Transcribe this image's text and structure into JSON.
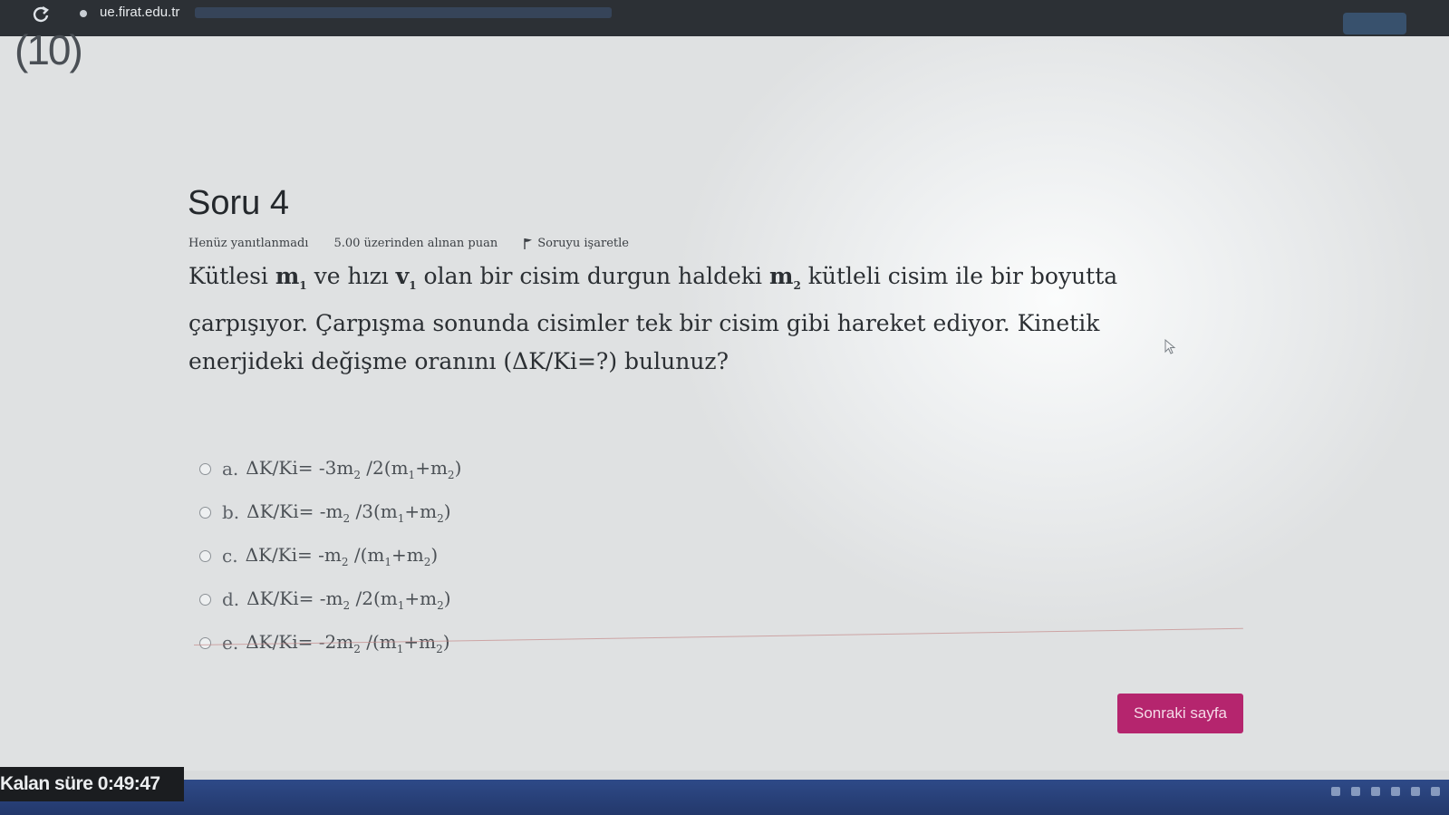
{
  "browser": {
    "url_host": "ue.firat.edu.tr"
  },
  "page": {
    "logo_fragment": "(10)"
  },
  "question": {
    "title": "Soru 4",
    "status": "Henüz yanıtlanmadı",
    "points": "5.00 üzerinden alınan puan",
    "flag_label": "Soruyu işaretle",
    "text_parts": {
      "p1": "Kütlesi ",
      "m1": "m",
      "m1_sub": "1",
      "p2": " ve hızı ",
      "v1": "v",
      "v1_sub": "1",
      "p3": " olan bir cisim durgun haldeki ",
      "m2": "m",
      "m2_sub": "2",
      "p4": " kütleli cisim ile bir boyutta çarpışıyor. Çarpışma sonunda cisimler tek bir cisim gibi hareket ediyor. Kinetik enerjideki değişme oranını (ΔK/Ki=?) bulunuz?"
    },
    "answers": [
      {
        "letter": "a.",
        "lhs": "ΔK/Ki= -3m",
        "s1": "2",
        "mid": " /2(m",
        "s2": "1",
        "plus": "+m",
        "s3": "2",
        "end": ")"
      },
      {
        "letter": "b.",
        "lhs": "ΔK/Ki= -m",
        "s1": "2",
        "mid": " /3(m",
        "s2": "1",
        "plus": "+m",
        "s3": "2",
        "end": ")"
      },
      {
        "letter": "c.",
        "lhs": "ΔK/Ki= -m",
        "s1": "2",
        "mid": " /(m",
        "s2": "1",
        "plus": "+m",
        "s3": "2",
        "end": ")"
      },
      {
        "letter": "d.",
        "lhs": "ΔK/Ki= -m",
        "s1": "2",
        "mid": " /2(m",
        "s2": "1",
        "plus": "+m",
        "s3": "2",
        "end": ")"
      },
      {
        "letter": "e.",
        "lhs": "ΔK/Ki= -2m",
        "s1": "2",
        "mid": " /(m",
        "s2": "1",
        "plus": "+m",
        "s3": "2",
        "end": ")"
      }
    ]
  },
  "navigation": {
    "next_label": "Sonraki sayfa"
  },
  "timer": {
    "text": "Kalan süre 0:49:47"
  },
  "colors": {
    "accent": "#b5256e",
    "taskbar": "#2e4a88"
  }
}
